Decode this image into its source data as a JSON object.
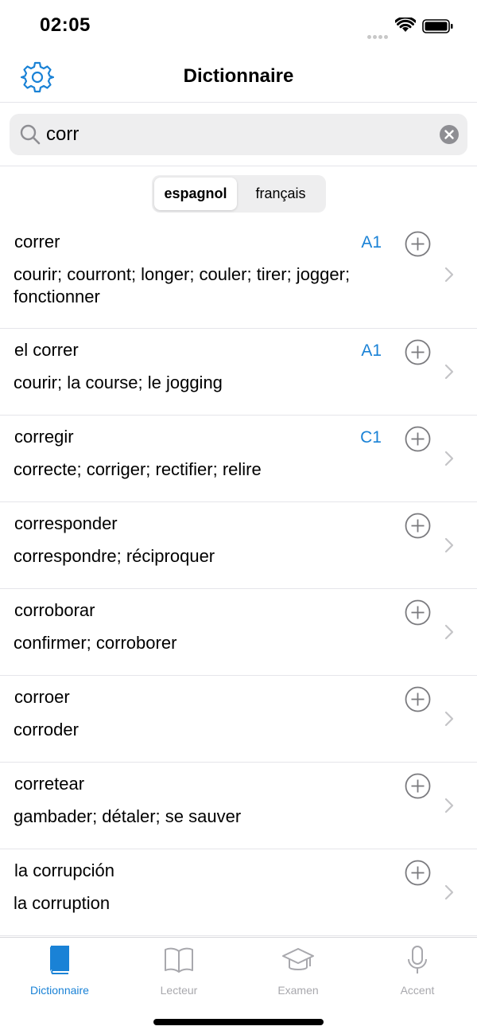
{
  "status": {
    "time": "02:05"
  },
  "nav": {
    "title": "Dictionnaire"
  },
  "search": {
    "value": "corr",
    "placeholder": ""
  },
  "segments": [
    {
      "label": "espagnol",
      "selected": true
    },
    {
      "label": "français",
      "selected": false
    }
  ],
  "entries": [
    {
      "word": "correr",
      "level": "A1",
      "translation": "courir; courront; longer; couler; tirer; jogger; fonctionner"
    },
    {
      "word": "el correr",
      "level": "A1",
      "translation": "courir; la course; le jogging"
    },
    {
      "word": "corregir",
      "level": "C1",
      "translation": "correcte; corriger; rectifier; relire"
    },
    {
      "word": "corresponder",
      "level": "",
      "translation": "correspondre; réciproquer"
    },
    {
      "word": "corroborar",
      "level": "",
      "translation": "confirmer; corroborer"
    },
    {
      "word": "corroer",
      "level": "",
      "translation": "corroder"
    },
    {
      "word": "corretear",
      "level": "",
      "translation": "gambader; détaler; se sauver"
    },
    {
      "word": "la corrupción",
      "level": "",
      "translation": "la corruption"
    }
  ],
  "tabs": [
    {
      "label": "Dictionnaire",
      "icon": "book-icon",
      "active": true
    },
    {
      "label": "Lecteur",
      "icon": "open-book-icon",
      "active": false
    },
    {
      "label": "Examen",
      "icon": "graduation-cap-icon",
      "active": false
    },
    {
      "label": "Accent",
      "icon": "microphone-icon",
      "active": false
    }
  ],
  "colors": {
    "accent": "#1a82d6",
    "inactive": "#a8a8ad",
    "separator": "#e5e5ea",
    "search_bg": "#eeeeef"
  }
}
